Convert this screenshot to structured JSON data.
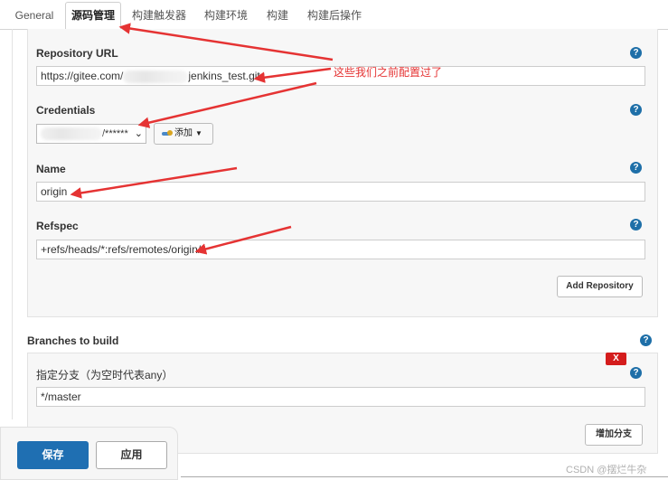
{
  "tabs": [
    "General",
    "源码管理",
    "构建触发器",
    "构建环境",
    "构建",
    "构建后操作"
  ],
  "repository": {
    "url_label": "Repository URL",
    "url_value_prefix": "https://gitee.com/",
    "url_value_suffix": "jenkins_test.git",
    "credentials_label": "Credentials",
    "credentials_value": "/******",
    "add_label": "添加",
    "name_label": "Name",
    "name_value": "origin",
    "refspec_label": "Refspec",
    "refspec_value": "+refs/heads/*:refs/remotes/origin/*",
    "add_repository": "Add Repository"
  },
  "branches": {
    "title": "Branches to build",
    "spec_label": "指定分支（为空时代表any）",
    "spec_value": "*/master",
    "delete_label": "X",
    "add_branch": "增加分支"
  },
  "annotation": "这些我们之前配置过了",
  "buttons": {
    "save": "保存",
    "apply": "应用"
  },
  "help_symbol": "?",
  "watermark": "CSDN @摆烂牛杂",
  "colors": {
    "primary": "#1f6fb2",
    "annotation": "#e53333",
    "delete": "#d41c1c"
  }
}
